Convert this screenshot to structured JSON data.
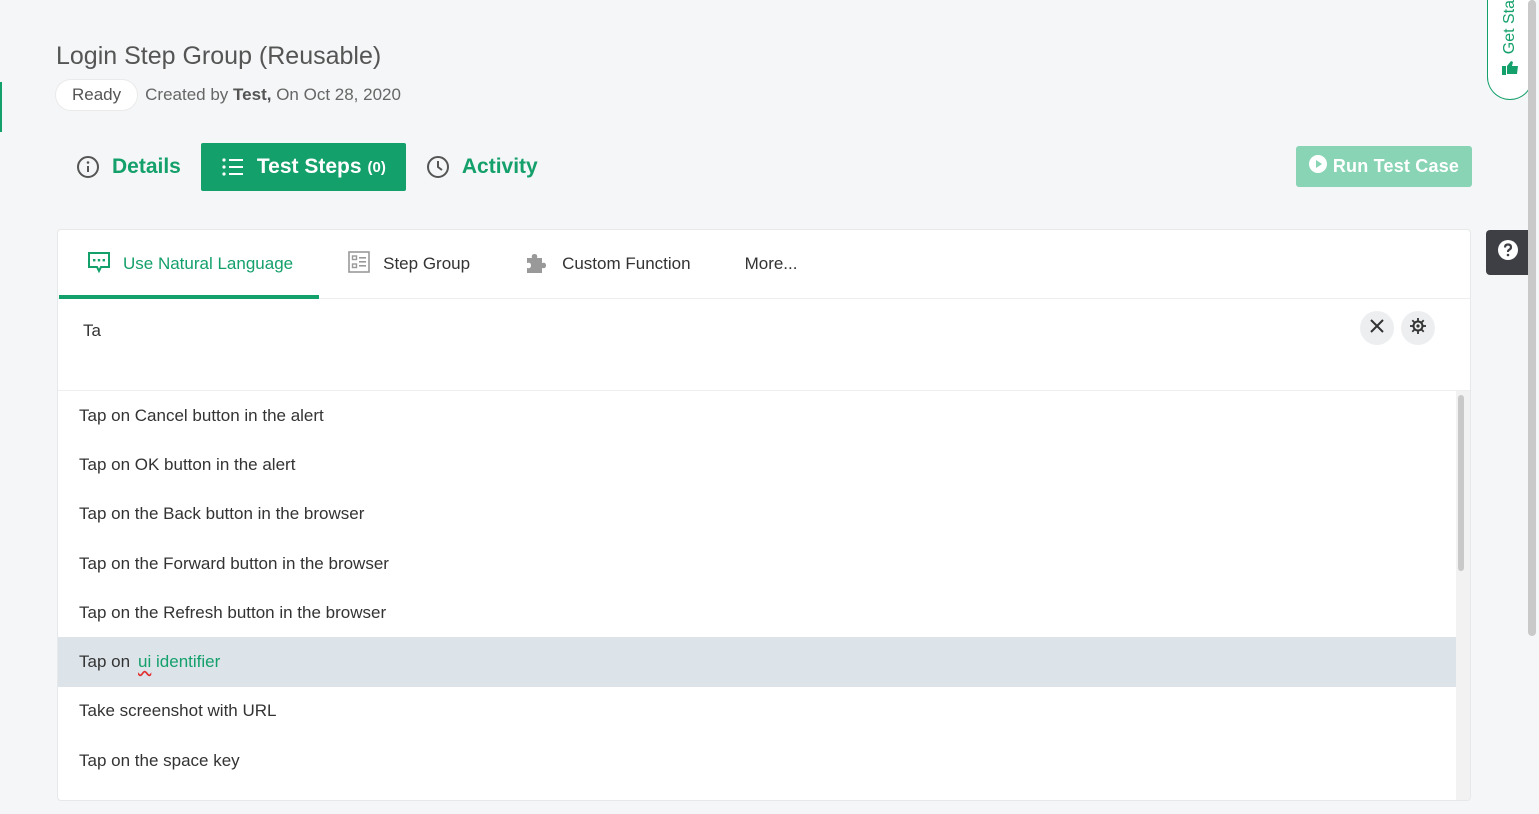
{
  "page": {
    "title": "Login Step Group (Reusable)",
    "status": "Ready",
    "created_prefix": "Created by",
    "created_by": "Test,",
    "created_on": "On Oct 28, 2020"
  },
  "tabs": [
    {
      "label": "Details",
      "icon": "info-icon"
    },
    {
      "label": "Test Steps",
      "count": "(0)",
      "icon": "list-icon"
    },
    {
      "label": "Activity",
      "icon": "clock-icon"
    }
  ],
  "run_button": {
    "label": "Run Test Case",
    "icon": "play-circle-icon"
  },
  "get_started": {
    "label": "Get Sta",
    "icon": "thumbs-up-icon"
  },
  "help": {
    "icon": "question-icon"
  },
  "editor": {
    "subtabs": [
      {
        "label": "Use Natural Language",
        "icon": "chat-icon",
        "active": true
      },
      {
        "label": "Step Group",
        "icon": "step-group-icon"
      },
      {
        "label": "Custom Function",
        "icon": "puzzle-icon"
      },
      {
        "label": "More...",
        "icon": ""
      }
    ],
    "input_value": "Ta"
  },
  "suggestions": [
    {
      "text": "Tap on Cancel button in the alert"
    },
    {
      "text": "Tap on OK button in the alert"
    },
    {
      "text": "Tap on the Back button in the browser"
    },
    {
      "text": "Tap on the Forward button in the browser"
    },
    {
      "text": "Tap on the Refresh button in the browser"
    },
    {
      "text": "Tap on",
      "param_a": "ui",
      "param_b": "identifier",
      "highlighted": true
    },
    {
      "text": "Take screenshot with URL"
    },
    {
      "text": "Tap on the space key"
    }
  ],
  "colors": {
    "accent": "#14a06b",
    "run_disabled": "#88d4b5",
    "highlight_row": "#dce3e9"
  }
}
